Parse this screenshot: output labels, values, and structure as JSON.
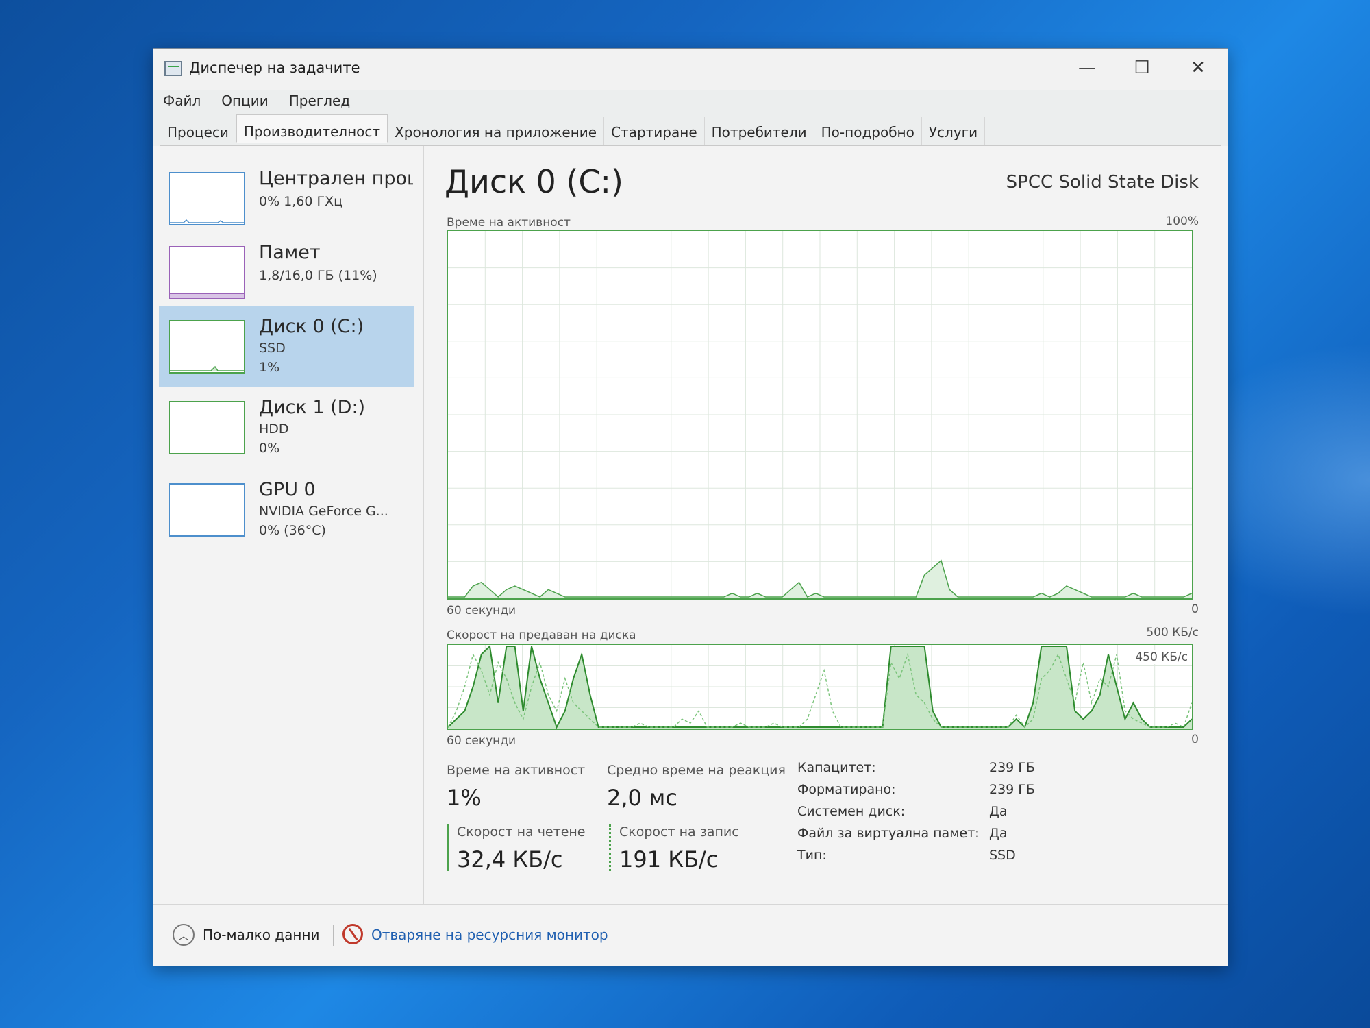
{
  "window": {
    "title": "Диспечер на задачите",
    "controls": {
      "minimize": "—",
      "maximize": "☐",
      "close": "✕"
    }
  },
  "menu": [
    "Файл",
    "Опции",
    "Преглед"
  ],
  "tabs": [
    "Процеси",
    "Производителност",
    "Хронология на приложение",
    "Стартиране",
    "Потребители",
    "По-подробно",
    "Услуги"
  ],
  "active_tab": "Производителност",
  "sidebar": [
    {
      "name": "Централен проце",
      "line1": "0% 1,60 ГХц",
      "line2": "",
      "color": "#4d8fcc"
    },
    {
      "name": "Памет",
      "line1": "1,8/16,0 ГБ (11%)",
      "line2": "",
      "color": "#9a62b8"
    },
    {
      "name": "Диск 0 (C:)",
      "line1": "SSD",
      "line2": "1%",
      "color": "#4ca24c",
      "selected": true
    },
    {
      "name": "Диск 1 (D:)",
      "line1": "HDD",
      "line2": "0%",
      "color": "#4ca24c"
    },
    {
      "name": "GPU 0",
      "line1": "NVIDIA GeForce G...",
      "line2": "0% (36°C)",
      "color": "#4d8fcc"
    }
  ],
  "main": {
    "title": "Диск 0 (C:)",
    "model": "SPCC Solid State Disk",
    "graph1": {
      "label": "Време на активност",
      "max": "100%",
      "xlabel": "60 секунди",
      "min": "0"
    },
    "graph2": {
      "label": "Скорост на предаван на диска",
      "max": "500 КБ/с",
      "inner_max": "450 КБ/с",
      "xlabel": "60 секунди",
      "min": "0"
    },
    "stats": {
      "active_label": "Време на активност",
      "active_value": "1%",
      "response_label": "Средно време на реакция",
      "response_value": "2,0 мс",
      "read_label": "Скорост на четене",
      "read_value": "32,4 КБ/с",
      "write_label": "Скорост на запис",
      "write_value": "191 КБ/с"
    },
    "properties": [
      {
        "key": "Капацитет:",
        "value": "239 ГБ"
      },
      {
        "key": "Форматирано:",
        "value": "239 ГБ"
      },
      {
        "key": "Системен диск:",
        "value": "Да"
      },
      {
        "key": "Файл за виртуална памет:",
        "value": "Да"
      },
      {
        "key": "Тип:",
        "value": "SSD"
      }
    ]
  },
  "footer": {
    "fewer": "По-малко данни",
    "resmon": "Отваряне на ресурсния монитор"
  },
  "colors": {
    "disk_green": "#4ca24c",
    "link_blue": "#1f5fb0",
    "selected_bg": "#b8d4ec"
  }
}
